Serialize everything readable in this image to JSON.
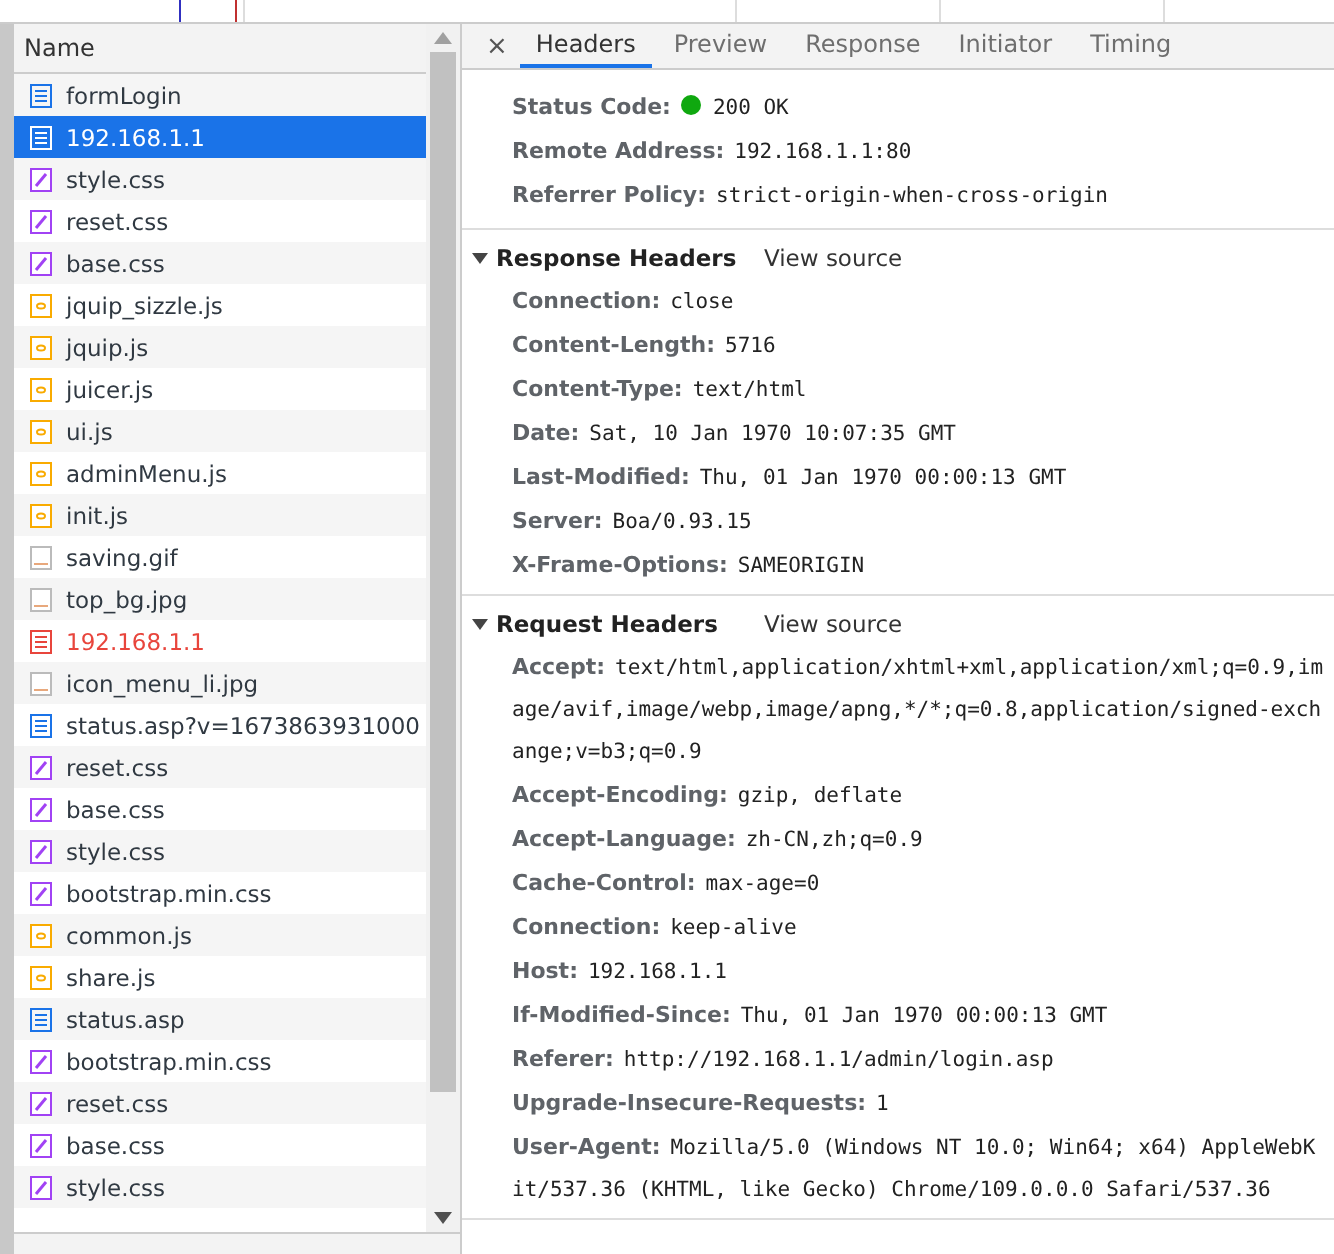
{
  "requests": {
    "column_title": "Name",
    "rows": [
      {
        "name": "formLogin",
        "kind": "document",
        "failed": false,
        "selected": false
      },
      {
        "name": "192.168.1.1",
        "kind": "document",
        "failed": false,
        "selected": true
      },
      {
        "name": "style.css",
        "kind": "stylesheet",
        "failed": false,
        "selected": false
      },
      {
        "name": "reset.css",
        "kind": "stylesheet",
        "failed": false,
        "selected": false
      },
      {
        "name": "base.css",
        "kind": "stylesheet",
        "failed": false,
        "selected": false
      },
      {
        "name": "jquip_sizzle.js",
        "kind": "script",
        "failed": false,
        "selected": false
      },
      {
        "name": "jquip.js",
        "kind": "script",
        "failed": false,
        "selected": false
      },
      {
        "name": "juicer.js",
        "kind": "script",
        "failed": false,
        "selected": false
      },
      {
        "name": "ui.js",
        "kind": "script",
        "failed": false,
        "selected": false
      },
      {
        "name": "adminMenu.js",
        "kind": "script",
        "failed": false,
        "selected": false
      },
      {
        "name": "init.js",
        "kind": "script",
        "failed": false,
        "selected": false
      },
      {
        "name": "saving.gif",
        "kind": "image",
        "failed": false,
        "selected": false
      },
      {
        "name": "top_bg.jpg",
        "kind": "image",
        "failed": false,
        "selected": false
      },
      {
        "name": "192.168.1.1",
        "kind": "document",
        "failed": true,
        "selected": false
      },
      {
        "name": "icon_menu_li.jpg",
        "kind": "image",
        "failed": false,
        "selected": false
      },
      {
        "name": "status.asp?v=1673863931000",
        "kind": "document",
        "failed": false,
        "selected": false
      },
      {
        "name": "reset.css",
        "kind": "stylesheet",
        "failed": false,
        "selected": false
      },
      {
        "name": "base.css",
        "kind": "stylesheet",
        "failed": false,
        "selected": false
      },
      {
        "name": "style.css",
        "kind": "stylesheet",
        "failed": false,
        "selected": false
      },
      {
        "name": "bootstrap.min.css",
        "kind": "stylesheet",
        "failed": false,
        "selected": false
      },
      {
        "name": "common.js",
        "kind": "script",
        "failed": false,
        "selected": false
      },
      {
        "name": "share.js",
        "kind": "script",
        "failed": false,
        "selected": false
      },
      {
        "name": "status.asp",
        "kind": "document",
        "failed": false,
        "selected": false
      },
      {
        "name": "bootstrap.min.css",
        "kind": "stylesheet",
        "failed": false,
        "selected": false
      },
      {
        "name": "reset.css",
        "kind": "stylesheet",
        "failed": false,
        "selected": false
      },
      {
        "name": "base.css",
        "kind": "stylesheet",
        "failed": false,
        "selected": false
      },
      {
        "name": "style.css",
        "kind": "stylesheet",
        "failed": false,
        "selected": false
      }
    ]
  },
  "tabs": [
    {
      "label": "Headers",
      "selected": true
    },
    {
      "label": "Preview",
      "selected": false
    },
    {
      "label": "Response",
      "selected": false
    },
    {
      "label": "Initiator",
      "selected": false
    },
    {
      "label": "Timing",
      "selected": false
    }
  ],
  "close_label": "×",
  "sections": [
    {
      "kind": "general",
      "rows": [
        {
          "name": "Status Code:",
          "value": "200 OK",
          "kind": "status"
        },
        {
          "name": "Remote Address:",
          "value": "192.168.1.1:80",
          "kind": "plain"
        },
        {
          "name": "Referrer Policy:",
          "value": "strict-origin-when-cross-origin",
          "kind": "plain"
        }
      ]
    },
    {
      "kind": "collapsible",
      "title": "Response Headers",
      "expanded": true,
      "link": "View source",
      "rows": [
        {
          "name": "Connection:",
          "value": "close",
          "kind": "plain"
        },
        {
          "name": "Content-Length:",
          "value": "5716",
          "kind": "plain"
        },
        {
          "name": "Content-Type:",
          "value": "text/html",
          "kind": "plain"
        },
        {
          "name": "Date:",
          "value": "Sat, 10 Jan 1970 10:07:35 GMT",
          "kind": "plain"
        },
        {
          "name": "Last-Modified:",
          "value": "Thu, 01 Jan 1970 00:00:13 GMT",
          "kind": "plain"
        },
        {
          "name": "Server:",
          "value": "Boa/0.93.15",
          "kind": "plain"
        },
        {
          "name": "X-Frame-Options:",
          "value": "SAMEORIGIN",
          "kind": "plain"
        }
      ]
    },
    {
      "kind": "collapsible",
      "title": "Request Headers",
      "expanded": true,
      "link": "View source",
      "rows": [
        {
          "name": "Accept:",
          "value": "text/html,application/xhtml+xml,application/xml;q=0.9,image/avif,image/webp,image/apng,*/*;q=0.8,application/signed-exchange;v=b3;q=0.9",
          "kind": "plain"
        },
        {
          "name": "Accept-Encoding:",
          "value": "gzip, deflate",
          "kind": "plain"
        },
        {
          "name": "Accept-Language:",
          "value": "zh-CN,zh;q=0.9",
          "kind": "plain"
        },
        {
          "name": "Cache-Control:",
          "value": "max-age=0",
          "kind": "plain"
        },
        {
          "name": "Connection:",
          "value": "keep-alive",
          "kind": "plain"
        },
        {
          "name": "Host:",
          "value": "192.168.1.1",
          "kind": "plain"
        },
        {
          "name": "If-Modified-Since:",
          "value": "Thu, 01 Jan 1970 00:00:13 GMT",
          "kind": "plain"
        },
        {
          "name": "Referer:",
          "value": "http://192.168.1.1/admin/login.asp",
          "kind": "plain"
        },
        {
          "name": "Upgrade-Insecure-Requests:",
          "value": "1",
          "kind": "plain"
        },
        {
          "name": "User-Agent:",
          "value": "Mozilla/5.0 (Windows NT 10.0; Win64; x64) AppleWebKit/537.36 (KHTML, like Gecko) Chrome/109.0.0.0 Safari/537.36",
          "kind": "plain"
        }
      ]
    }
  ]
}
